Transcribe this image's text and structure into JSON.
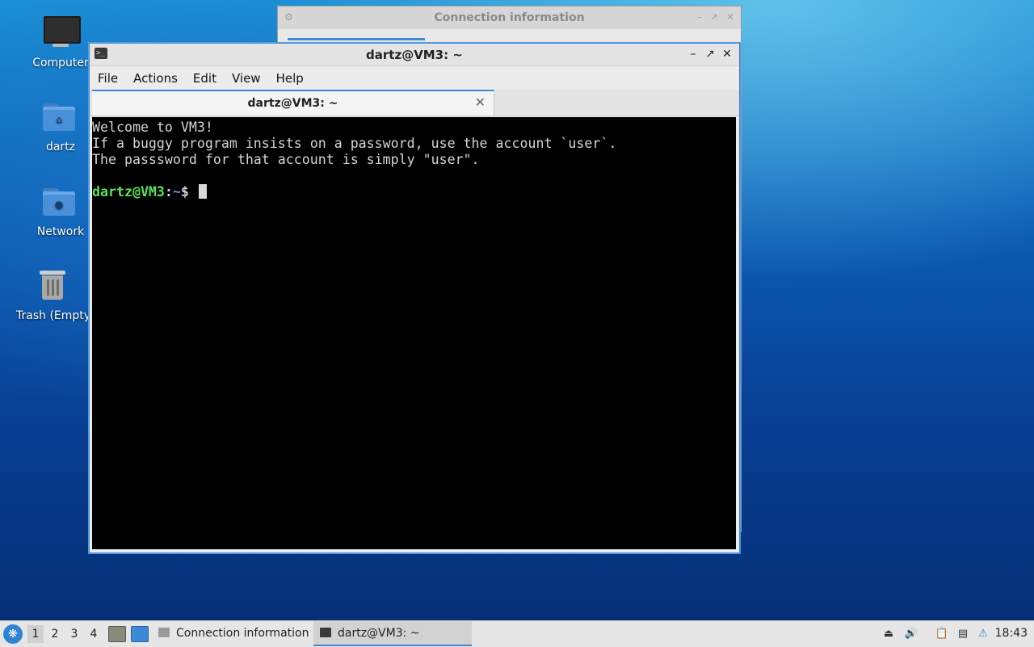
{
  "desktop": {
    "icons": [
      {
        "label": "Computer",
        "icon": "computer-icon"
      },
      {
        "label": "dartz",
        "icon": "home-folder-icon"
      },
      {
        "label": "Network",
        "icon": "network-folder-icon"
      },
      {
        "label": "Trash (Empty)",
        "icon": "trash-icon"
      }
    ]
  },
  "background_window": {
    "title": "Connection information"
  },
  "terminal_window": {
    "title": "dartz@VM3: ~",
    "menu": [
      "File",
      "Actions",
      "Edit",
      "View",
      "Help"
    ],
    "tab_title": "dartz@VM3: ~",
    "lines": [
      "Welcome to VM3!",
      "If a buggy program insists on a password, use the account `user`.",
      "The passsword for that account is simply \"user\"."
    ],
    "prompt": {
      "user_host": "dartz@VM3",
      "separator": ":",
      "path": "~",
      "symbol": "$ "
    }
  },
  "taskbar": {
    "desktops": [
      "1",
      "2",
      "3",
      "4"
    ],
    "active_desktop": "1",
    "tasks": [
      {
        "label": "Connection information",
        "icon": "plug-icon",
        "active": false
      },
      {
        "label": "dartz@VM3: ~",
        "icon": "terminal-icon",
        "active": true
      }
    ],
    "clock": "18:43"
  },
  "colors": {
    "accent": "#3e89d6",
    "terminal_bg": "#000000",
    "prompt_user": "#5ce05c",
    "prompt_path": "#6a8fe8"
  }
}
